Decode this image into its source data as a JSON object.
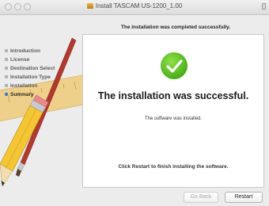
{
  "window": {
    "title": "Install TASCAM US-1200_1.00"
  },
  "header": {
    "message": "The installation was completed successfully."
  },
  "sidebar": {
    "steps": [
      {
        "label": "Introduction",
        "state": "done"
      },
      {
        "label": "License",
        "state": "done"
      },
      {
        "label": "Destination Select",
        "state": "done"
      },
      {
        "label": "Installation Type",
        "state": "done"
      },
      {
        "label": "Installation",
        "state": "done"
      },
      {
        "label": "Summary",
        "state": "active"
      }
    ]
  },
  "main": {
    "heading": "The installation was successful.",
    "subtext": "The software was installed.",
    "restart_note": "Click Restart to finish installing the software."
  },
  "buttons": {
    "back_label": "Go Back",
    "back_enabled": false,
    "restart_label": "Restart"
  },
  "colors": {
    "success_green": "#4bb01b",
    "active_step_dot": "#3b86e0",
    "pencil_yellow": "#f4c534"
  },
  "icons": {
    "status": "checkmark-icon",
    "decoration": "pencil-ruler-brush-icon",
    "installer": "package-icon"
  }
}
